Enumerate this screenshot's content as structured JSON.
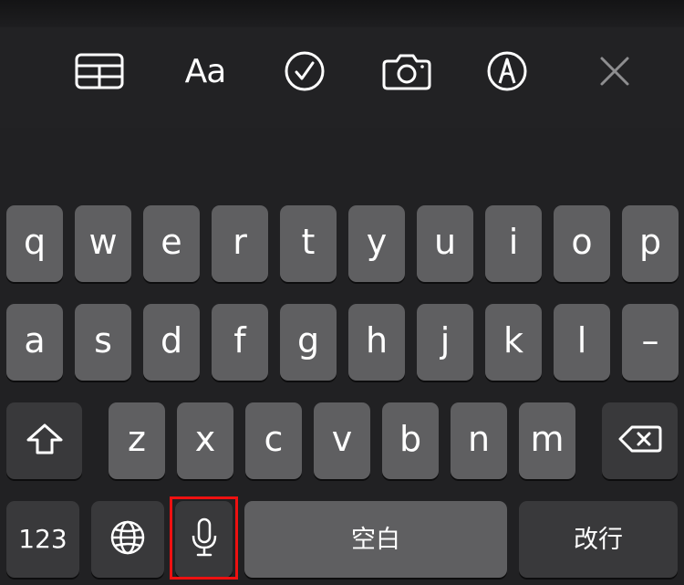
{
  "toolbar": {
    "items": [
      {
        "icon": "table-icon"
      },
      {
        "label": "Aa",
        "icon": "text-format-icon"
      },
      {
        "icon": "checklist-icon"
      },
      {
        "icon": "camera-icon"
      },
      {
        "icon": "markup-pen-icon"
      },
      {
        "icon": "close-icon"
      }
    ]
  },
  "keyboard": {
    "row1": [
      "q",
      "w",
      "e",
      "r",
      "t",
      "y",
      "u",
      "i",
      "o",
      "p"
    ],
    "row2": [
      "a",
      "s",
      "d",
      "f",
      "g",
      "h",
      "j",
      "k",
      "l",
      "–"
    ],
    "row3": [
      "z",
      "x",
      "c",
      "v",
      "b",
      "n",
      "m"
    ],
    "shift_icon": "shift-icon",
    "delete_icon": "delete-icon",
    "numbers_label": "123",
    "globe_icon": "globe-icon",
    "mic_icon": "microphone-icon",
    "space_label": "空白",
    "return_label": "改行"
  },
  "colors": {
    "background": "#1f1f21",
    "key": "#5f5f61",
    "function_key": "#39393b",
    "highlight": "#ee1111",
    "text": "#ffffff"
  }
}
